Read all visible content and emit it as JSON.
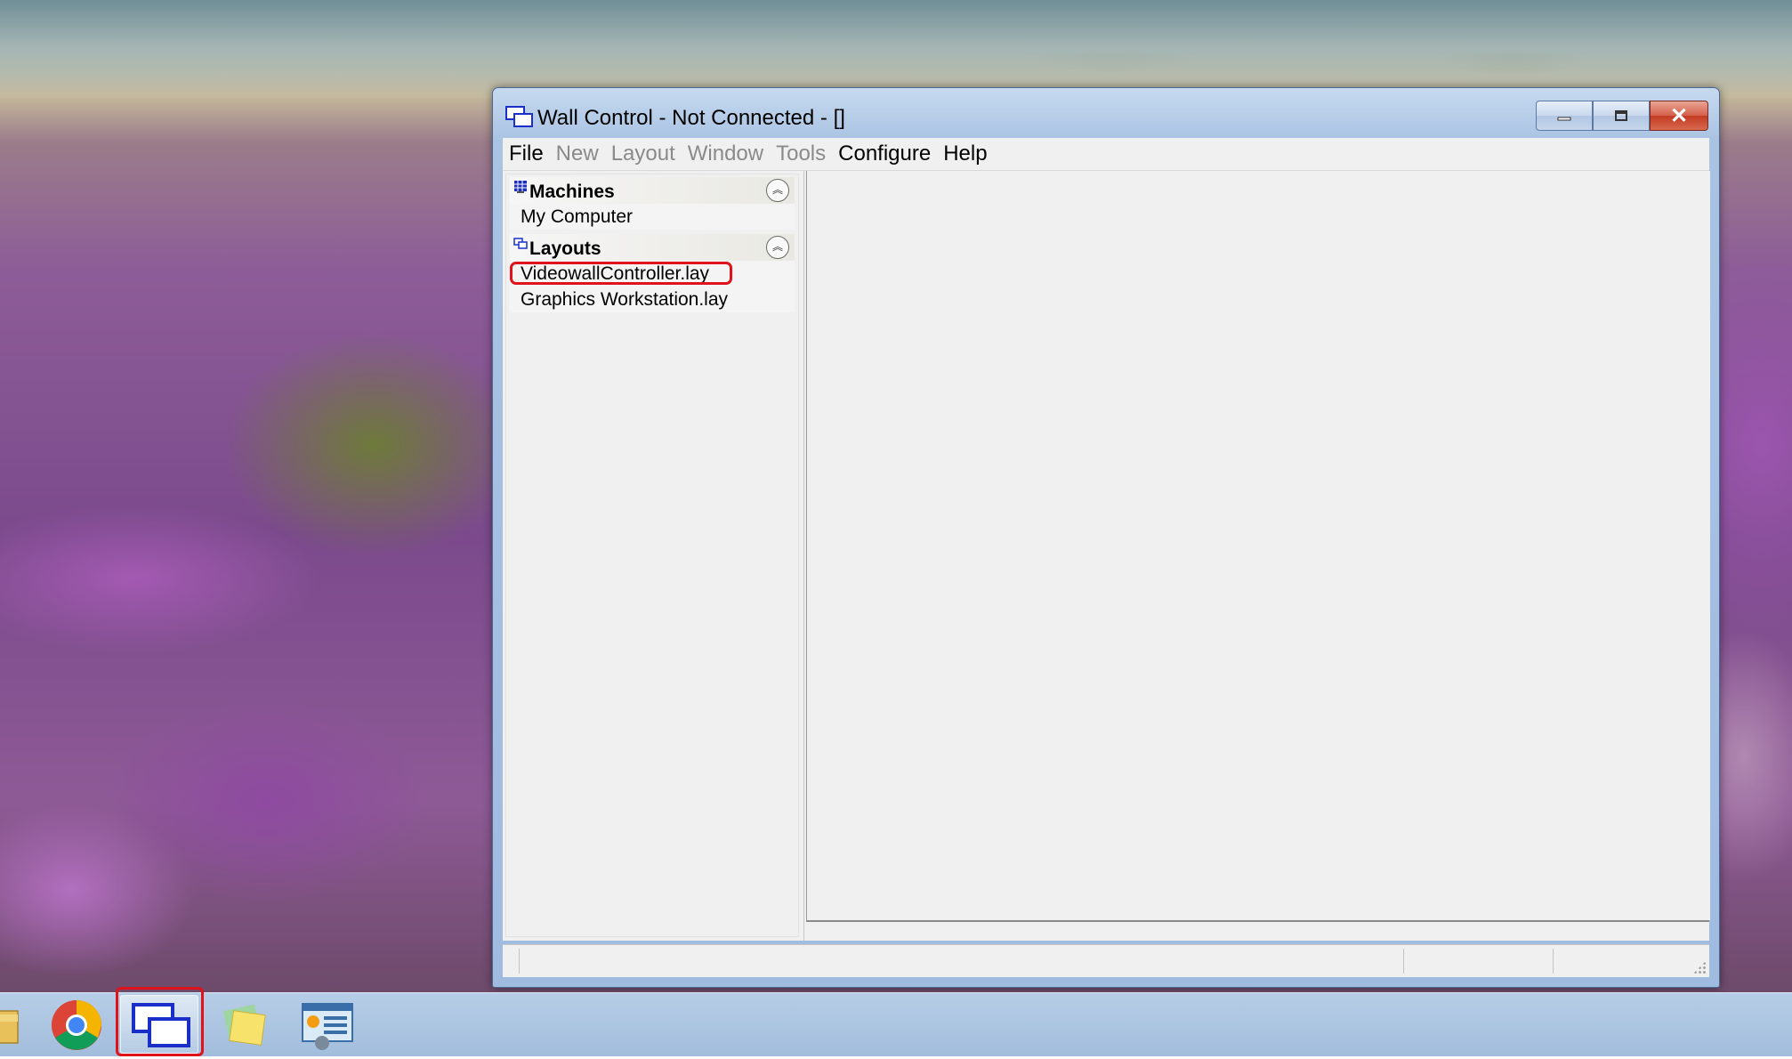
{
  "window": {
    "title": "Wall Control - Not Connected - []",
    "buttons": {
      "minimize": "—",
      "maximize": "☐",
      "close": "✕"
    }
  },
  "menu": {
    "items": [
      {
        "label": "File",
        "enabled": true
      },
      {
        "label": "New",
        "enabled": false
      },
      {
        "label": "Layout",
        "enabled": false
      },
      {
        "label": "Window",
        "enabled": false
      },
      {
        "label": "Tools",
        "enabled": false
      },
      {
        "label": "Configure",
        "enabled": true
      },
      {
        "label": "Help",
        "enabled": true
      }
    ]
  },
  "sidebar": {
    "machines": {
      "title": "Machines",
      "collapse_glyph": "︽",
      "items": [
        "My Computer"
      ]
    },
    "layouts": {
      "title": "Layouts",
      "collapse_glyph": "︽",
      "items": [
        "VideowallController.lay",
        "Graphics Workstation.lay"
      ],
      "highlighted_index": 0
    }
  },
  "taskbar": {
    "apps": [
      {
        "name": "file-explorer"
      },
      {
        "name": "chrome"
      },
      {
        "name": "wall-control",
        "active": true
      },
      {
        "name": "sticky-notes"
      },
      {
        "name": "control-panel"
      }
    ]
  },
  "colors": {
    "annotation": "#e0121b",
    "title_bar": "#a9c3e3",
    "close_button": "#c23a22"
  }
}
